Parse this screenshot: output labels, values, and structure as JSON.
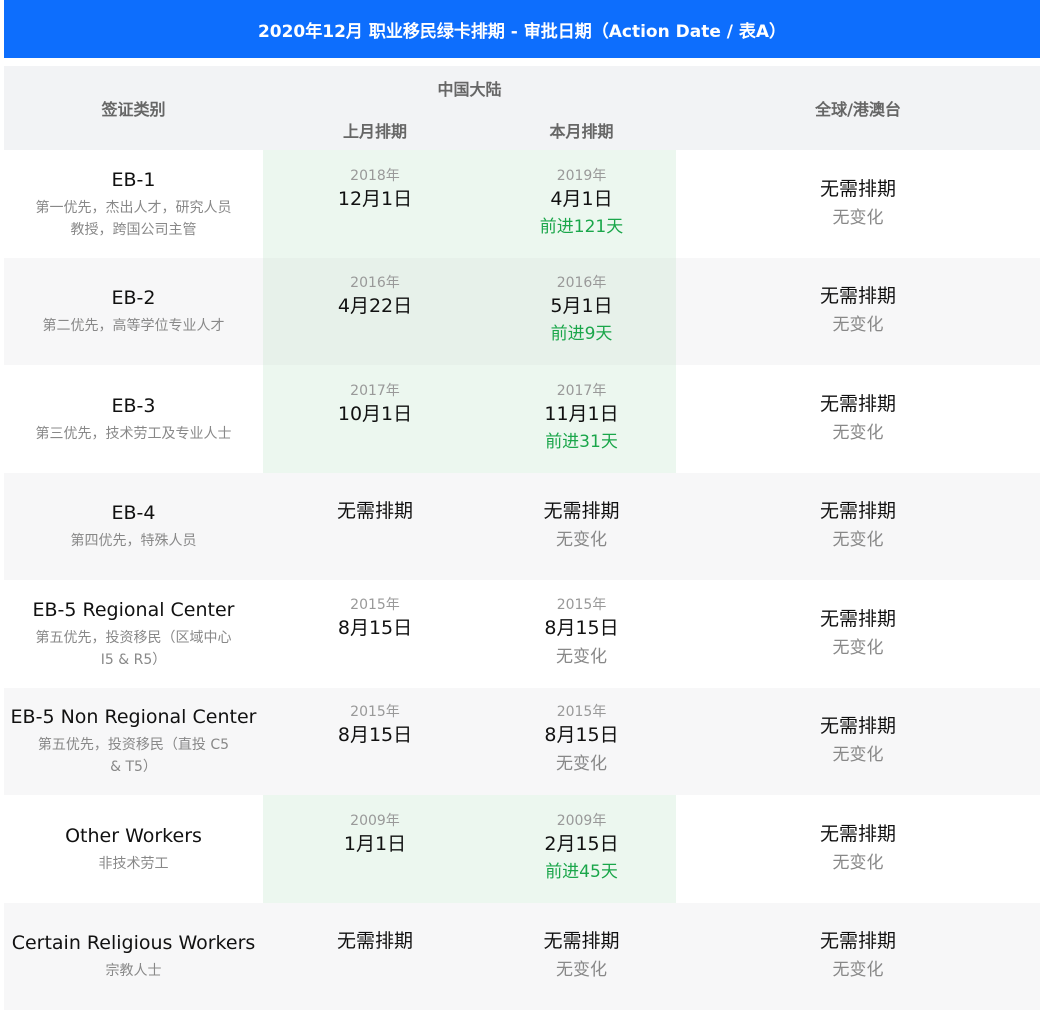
{
  "title": "2020年12月 职业移民绿卡排期 - 审批日期（Action Date / 表A）",
  "header": {
    "category": "签证类别",
    "china_group": "中国大陆",
    "last_month": "上月排期",
    "this_month": "本月排期",
    "global": "全球/港澳台"
  },
  "rows": [
    {
      "name": "EB-1",
      "desc1": "第一优先，杰出人才，研究人员",
      "desc2": "教授，跨国公司主管",
      "last_year": "2018年",
      "last_date": "12月1日",
      "this_year": "2019年",
      "this_date": "4月1日",
      "this_change": "前进121天",
      "global_status": "无需排期",
      "global_change": "无变化"
    },
    {
      "name": "EB-2",
      "desc1": "第二优先，高等学位专业人才",
      "desc2": "",
      "last_year": "2016年",
      "last_date": "4月22日",
      "this_year": "2016年",
      "this_date": "5月1日",
      "this_change": "前进9天",
      "global_status": "无需排期",
      "global_change": "无变化"
    },
    {
      "name": "EB-3",
      "desc1": "第三优先，技术劳工及专业人士",
      "desc2": "",
      "last_year": "2017年",
      "last_date": "10月1日",
      "this_year": "2017年",
      "this_date": "11月1日",
      "this_change": "前进31天",
      "global_status": "无需排期",
      "global_change": "无变化"
    },
    {
      "name": "EB-4",
      "desc1": "第四优先，特殊人员",
      "desc2": "",
      "last_year": "",
      "last_date": "无需排期",
      "this_year": "",
      "this_date": "无需排期",
      "this_change": "无变化",
      "global_status": "无需排期",
      "global_change": "无变化"
    },
    {
      "name": "EB-5 Regional Center",
      "desc1": "第五优先，投资移民（区域中心",
      "desc2": "I5 & R5）",
      "last_year": "2015年",
      "last_date": "8月15日",
      "this_year": "2015年",
      "this_date": "8月15日",
      "this_change": "无变化",
      "global_status": "无需排期",
      "global_change": "无变化"
    },
    {
      "name": "EB-5 Non Regional Center",
      "desc1": "第五优先，投资移民（直投 C5",
      "desc2": "& T5）",
      "last_year": "2015年",
      "last_date": "8月15日",
      "this_year": "2015年",
      "this_date": "8月15日",
      "this_change": "无变化",
      "global_status": "无需排期",
      "global_change": "无变化"
    },
    {
      "name": "Other Workers",
      "desc1": "非技术劳工",
      "desc2": "",
      "last_year": "2009年",
      "last_date": "1月1日",
      "this_year": "2009年",
      "this_date": "2月15日",
      "this_change": "前进45天",
      "global_status": "无需排期",
      "global_change": "无变化"
    },
    {
      "name": "Certain Religious Workers",
      "desc1": "宗教人士",
      "desc2": "",
      "last_year": "",
      "last_date": "无需排期",
      "this_year": "",
      "this_date": "无需排期",
      "this_change": "无变化",
      "global_status": "无需排期",
      "global_change": "无变化"
    }
  ],
  "colors": {
    "title_bg": "#0d6efd",
    "advance_text": "#1aa64a",
    "highlight_bg": "#ecf7ef"
  }
}
